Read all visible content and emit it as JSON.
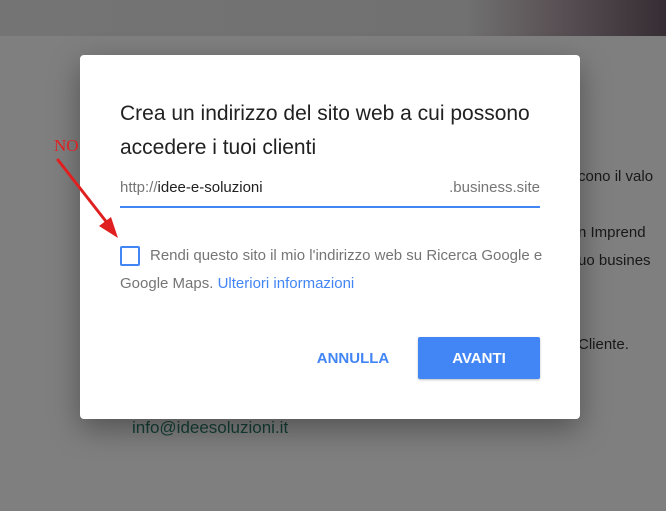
{
  "background": {
    "text_lines": [
      "cono il valo",
      "n Imprend",
      "uo busines",
      "Cliente."
    ],
    "email": "info@ideesoluzioni.it"
  },
  "dialog": {
    "title": "Crea un indirizzo del sito web a cui possono accedere i tuoi clienti",
    "url_prefix": "http://",
    "url_value": "idee-e-soluzioni",
    "url_suffix": ".business.site",
    "checkbox_checked": false,
    "checkbox_label": "Rendi questo sito il mio l'indirizzo web su Ricerca Google e Google Maps.",
    "learn_more_link": "Ulteriori informazioni",
    "cancel_label": "ANNULLA",
    "next_label": "AVANTI"
  },
  "annotation": {
    "label": "NO",
    "color": "#e02020"
  },
  "colors": {
    "accent": "#4285f4",
    "scrim": "rgba(0,0,0,0.5)"
  }
}
